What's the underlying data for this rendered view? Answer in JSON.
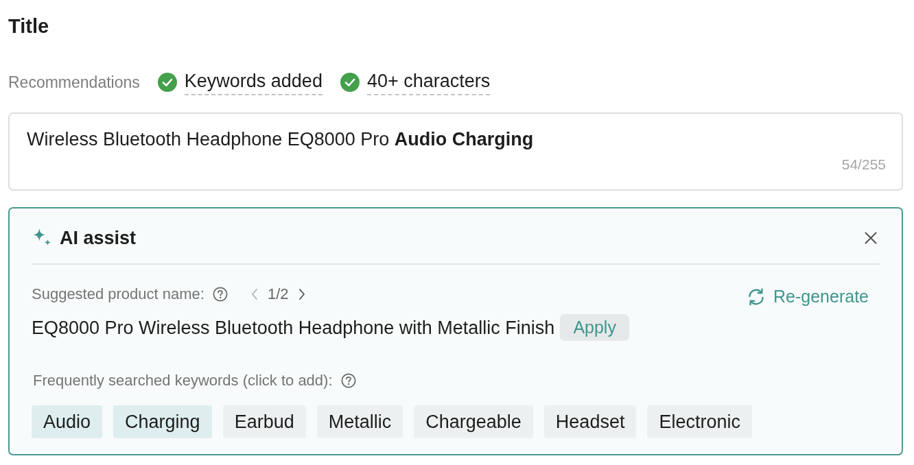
{
  "title": "Title",
  "recommendations": {
    "label": "Recommendations",
    "items": [
      {
        "text": "Keywords added",
        "done": true
      },
      {
        "text": "40+ characters",
        "done": true
      }
    ]
  },
  "title_field": {
    "value": "Wireless Bluetooth Headphone EQ8000 Pro **Audio Charging**",
    "counter": "54/255"
  },
  "ai_assist": {
    "title": "AI assist",
    "suggestion_label": "Suggested product name:",
    "pager": {
      "text": "1/2",
      "prev_disabled": true,
      "next_disabled": false
    },
    "regenerate": "Re-generate",
    "suggestion": "EQ8000 Pro Wireless Bluetooth Headphone with Metallic Finish",
    "apply": "Apply",
    "keywords_label": "Frequently searched keywords (click to add):",
    "keywords": [
      {
        "label": "Audio",
        "selected": true
      },
      {
        "label": "Charging",
        "selected": true
      },
      {
        "label": "Earbud",
        "selected": false
      },
      {
        "label": "Metallic",
        "selected": false
      },
      {
        "label": "Chargeable",
        "selected": false
      },
      {
        "label": "Headset",
        "selected": false
      },
      {
        "label": "Electronic",
        "selected": false
      }
    ]
  }
}
